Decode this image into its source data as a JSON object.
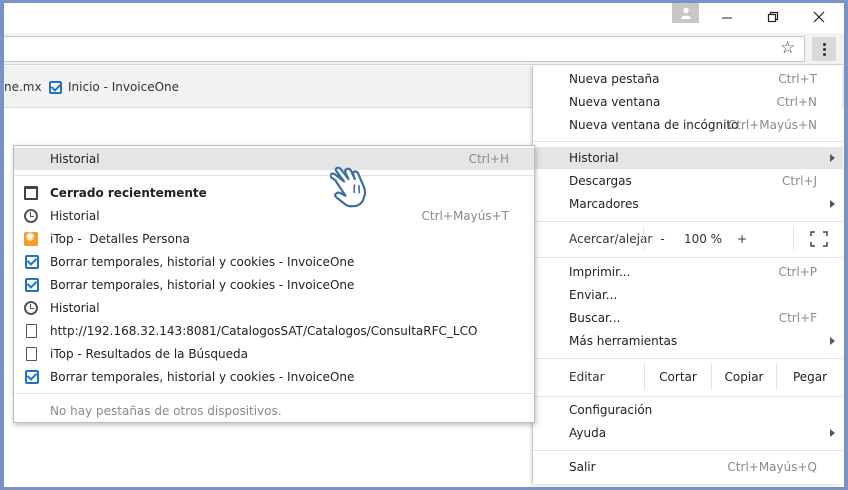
{
  "window": {
    "min_icon": "minimize-icon",
    "max_icon": "restore-icon",
    "close_icon": "close-icon"
  },
  "bookmarks": [
    {
      "label": "ne.mx"
    },
    {
      "label": "Inicio - InvoiceOne"
    }
  ],
  "main_menu": {
    "new_tab": {
      "label": "Nueva pestaña",
      "shortcut": "Ctrl+T"
    },
    "new_window": {
      "label": "Nueva ventana",
      "shortcut": "Ctrl+N"
    },
    "incognito": {
      "label": "Nueva ventana de incógnito",
      "shortcut": "Ctrl+Mayús+N"
    },
    "history": {
      "label": "Historial"
    },
    "downloads": {
      "label": "Descargas",
      "shortcut": "Ctrl+J"
    },
    "bookmarks": {
      "label": "Marcadores"
    },
    "zoom": {
      "label": "Acercar/alejar",
      "minus": "-",
      "value": "100 %",
      "plus": "+"
    },
    "print": {
      "label": "Imprimir...",
      "shortcut": "Ctrl+P"
    },
    "cast": {
      "label": "Enviar..."
    },
    "find": {
      "label": "Buscar...",
      "shortcut": "Ctrl+F"
    },
    "more_tools": {
      "label": "Más herramientas"
    },
    "edit": {
      "label": "Editar",
      "cut": "Cortar",
      "copy": "Copiar",
      "paste": "Pegar"
    },
    "settings": {
      "label": "Configuración"
    },
    "help": {
      "label": "Ayuda"
    },
    "exit": {
      "label": "Salir",
      "shortcut": "Ctrl+Mayús+Q"
    }
  },
  "history_menu": {
    "header": {
      "label": "Historial",
      "shortcut": "Ctrl+H"
    },
    "recently_closed": "Cerrado recientemente",
    "items": [
      {
        "label": "Historial",
        "shortcut": "Ctrl+Mayús+T",
        "icon": "history-icon"
      },
      {
        "label": "iTop -  Detalles Persona",
        "icon": "itop-icon"
      },
      {
        "label": "Borrar temporales, historial y cookies - InvoiceOne",
        "icon": "invoiceone-icon"
      },
      {
        "label": "Borrar temporales, historial y cookies - InvoiceOne",
        "icon": "invoiceone-icon"
      },
      {
        "label": "Historial",
        "icon": "history-icon"
      },
      {
        "label": "http://192.168.32.143:8081/CatalogosSAT/Catalogos/ConsultaRFC_LCO",
        "icon": "page-icon"
      },
      {
        "label": "iTop - Resultados de la Búsqueda",
        "icon": "page-icon"
      },
      {
        "label": "Borrar temporales, historial y cookies - InvoiceOne",
        "icon": "invoiceone-icon"
      }
    ],
    "no_devices": "No hay pestañas de otros dispositivos."
  }
}
